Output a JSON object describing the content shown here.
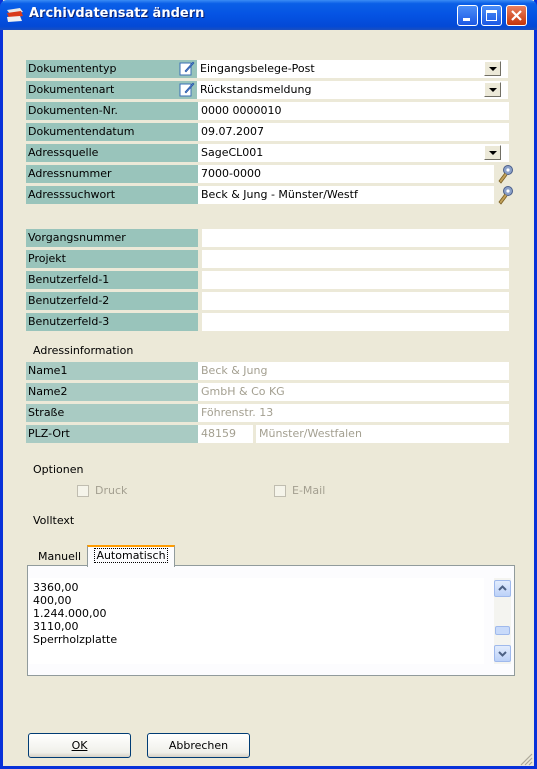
{
  "window": {
    "title": "Archivdatensatz ändern"
  },
  "fields": [
    {
      "label": "Dokumententyp",
      "value": "Eingangsbelege-Post"
    },
    {
      "label": "Dokumentenart",
      "value": "Rückstandsmeldung"
    },
    {
      "label": "Dokumenten-Nr.",
      "value": "0000 0000010"
    },
    {
      "label": "Dokumentendatum",
      "value": "09.07.2007"
    },
    {
      "label": "Adressquelle",
      "value": "SageCL001"
    },
    {
      "label": "Adressnummer",
      "value": "7000-0000"
    },
    {
      "label": "Adresssuchwort",
      "value": "Beck & Jung - Münster/Westf"
    }
  ],
  "custom_fields": [
    {
      "label": "Vorgangsnummer",
      "value": ""
    },
    {
      "label": "Projekt",
      "value": ""
    },
    {
      "label": "Benutzerfeld-1",
      "value": ""
    },
    {
      "label": "Benutzerfeld-2",
      "value": ""
    },
    {
      "label": "Benutzerfeld-3",
      "value": ""
    }
  ],
  "address_info": {
    "heading": "Adressinformation",
    "rows": [
      {
        "label": "Name1",
        "value": "Beck & Jung"
      },
      {
        "label": "Name2",
        "value": "GmbH & Co KG"
      },
      {
        "label": "Straße",
        "value": "Föhrenstr. 13"
      },
      {
        "label": "PLZ-Ort",
        "plz": "48159",
        "ort": "Münster/Westfalen"
      }
    ]
  },
  "options": {
    "heading": "Optionen",
    "druck": {
      "label": "Druck",
      "checked": false
    },
    "email": {
      "label": "E-Mail",
      "checked": false
    }
  },
  "volltext": {
    "heading": "Volltext",
    "tabs": [
      {
        "label": "Manuell"
      },
      {
        "label": "Automatisch",
        "active": true
      }
    ],
    "lines": [
      "3360,00",
      "400,00",
      "1.244.000,00",
      "3110,00",
      "Sperrholzplatte"
    ]
  },
  "buttons": {
    "ok": "OK",
    "cancel": "Abbrechen"
  },
  "colors": {
    "titlebar": "#0553e3",
    "label_bg": "#99c4bb",
    "window_bg": "#ece9d8"
  }
}
